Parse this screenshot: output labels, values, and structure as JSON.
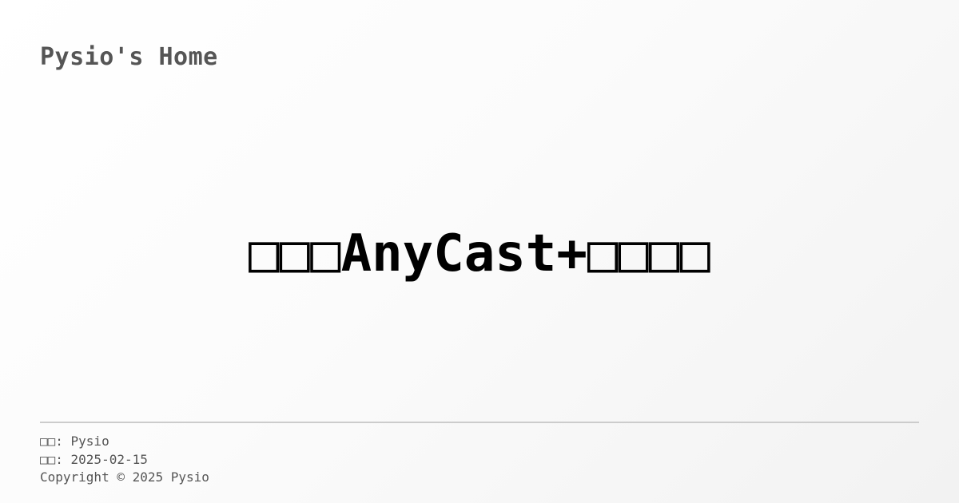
{
  "header": {
    "site_title": "Pysio's Home"
  },
  "main": {
    "post_title": "□□□AnyCast+□□□□"
  },
  "footer": {
    "author_label": "□□",
    "author_name": "Pysio",
    "date_label": "□□",
    "date_value": "2025-02-15",
    "copyright": "Copyright © 2025 Pysio"
  },
  "colors": {
    "background_start": "#ffffff",
    "background_end": "#f2f2f2",
    "site_title": "#555555",
    "post_title": "#000000",
    "divider": "#cccccc",
    "meta_text": "#555555"
  }
}
